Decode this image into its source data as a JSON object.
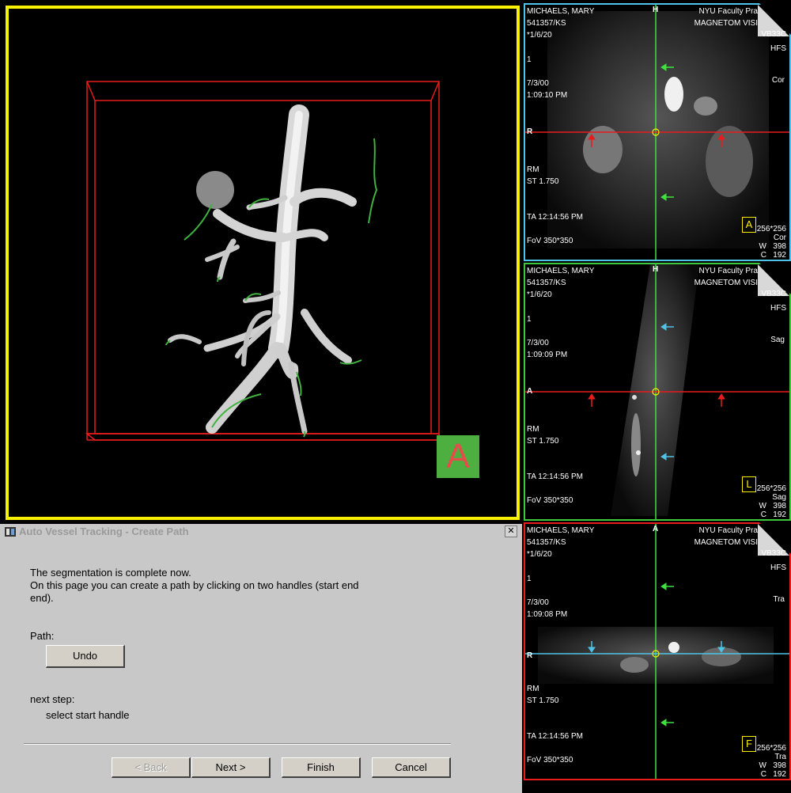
{
  "viewport3d": {
    "orientation_label": "A",
    "frame_color": "#f7f000",
    "bbox_color": "#e81c1c"
  },
  "mpr_views": [
    {
      "patient_name": "MICHAELS, MARY",
      "patient_id": "541357/KS",
      "dob": "*1/6/20",
      "institution": "NYU Faculty Pra",
      "scanner": "MAGNETOM VISI",
      "seq_tag": "VB33C",
      "patient_pos": "HFS",
      "plane": "Cor",
      "image_num": "1",
      "date": "7/3/00",
      "time": "1:09:10 PM",
      "top_dir": "H",
      "left_dir": "R",
      "rm": "RM",
      "st": "ST 1.750",
      "ta": "TA 12:14:56 PM",
      "fov": "FoV 350*350",
      "matrix": "256*256",
      "plane_short": "Cor",
      "w": "W   398",
      "c": "C   192",
      "orient_box": "A",
      "frame_color": "#4fc3e6"
    },
    {
      "patient_name": "MICHAELS, MARY",
      "patient_id": "541357/KS",
      "dob": "*1/6/20",
      "institution": "NYU Faculty Pra",
      "scanner": "MAGNETOM VISI",
      "seq_tag": "VB33C",
      "patient_pos": "HFS",
      "plane": "Sag",
      "image_num": "1",
      "date": "7/3/00",
      "time": "1:09:09 PM",
      "top_dir": "H",
      "left_dir": "A",
      "rm": "RM",
      "st": "ST 1.750",
      "ta": "TA 12:14:56 PM",
      "fov": "FoV 350*350",
      "matrix": "256*256",
      "plane_short": "Sag",
      "w": "W   398",
      "c": "C   192",
      "orient_box": "L",
      "frame_color": "#3ec83e"
    },
    {
      "patient_name": "MICHAELS, MARY",
      "patient_id": "541357/KS",
      "dob": "*1/6/20",
      "institution": "NYU Faculty Pra",
      "scanner": "MAGNETOM VISI",
      "seq_tag": "VB33C",
      "patient_pos": "HFS",
      "plane": "Tra",
      "image_num": "1",
      "date": "7/3/00",
      "time": "1:09:08 PM",
      "top_dir": "A",
      "left_dir": "R",
      "rm": "RM",
      "st": "ST 1.750",
      "ta": "TA 12:14:56 PM",
      "fov": "FoV 350*350",
      "matrix": "256*256",
      "plane_short": "Tra",
      "w": "W   398",
      "c": "C   192",
      "orient_box": "F",
      "frame_color": "#e81c1c"
    }
  ],
  "dialog": {
    "title": "Auto Vessel Tracking - Create Path",
    "close_label": "✕",
    "message_line1": "The segmentation is complete now.",
    "message_line2": "On this page you can create a path by clicking on two handles (start end",
    "message_line3": "end).",
    "path_label": "Path:",
    "undo_label": "Undo",
    "next_step_label": "next step:",
    "next_step_value": "select start handle",
    "back_label": "< Back",
    "next_label": "Next >",
    "finish_label": "Finish",
    "cancel_label": "Cancel"
  }
}
